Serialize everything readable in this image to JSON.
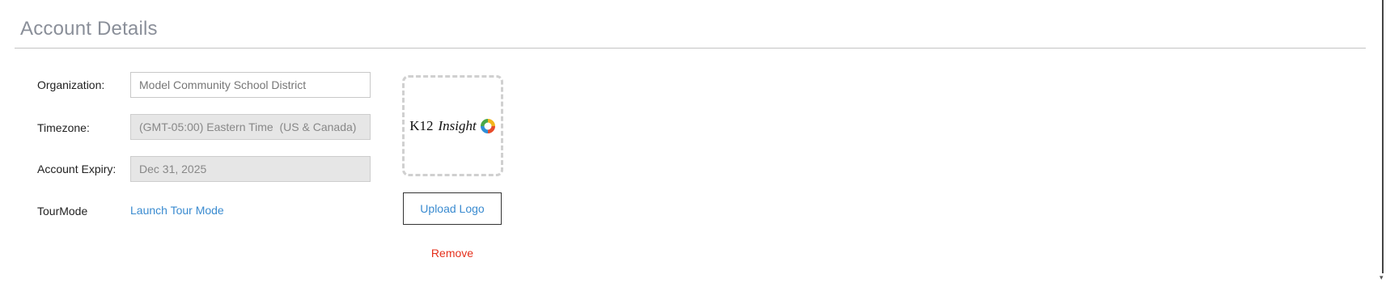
{
  "section": {
    "title": "Account Details"
  },
  "form": {
    "organization": {
      "label": "Organization:",
      "value": "Model Community School District"
    },
    "timezone": {
      "label": "Timezone:",
      "value": "(GMT-05:00) Eastern Time  (US & Canada)"
    },
    "expiry": {
      "label": "Account Expiry:",
      "value": "Dec 31, 2025"
    },
    "tour": {
      "label": "TourMode",
      "link": "Launch Tour Mode"
    }
  },
  "logo": {
    "text_main": "K12",
    "text_italic": "Insight",
    "ring_colors": [
      "#f2b51d",
      "#e84c2b",
      "#2f8fd8",
      "#48a84a"
    ],
    "upload_label": "Upload Logo",
    "remove_label": "Remove"
  },
  "colors": {
    "link": "#3a8bd0",
    "danger": "#e5301c",
    "title": "#8a8f99"
  }
}
